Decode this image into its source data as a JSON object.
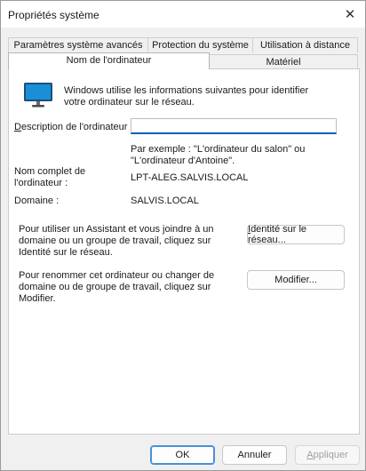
{
  "window": {
    "title": "Propriétés système",
    "close_glyph": "✕"
  },
  "tabs_row1": [
    {
      "label": "Paramètres système avancés"
    },
    {
      "label": "Protection du système"
    },
    {
      "label": "Utilisation à distance"
    }
  ],
  "tabs_row2": [
    {
      "label": "Nom de l'ordinateur",
      "active": true
    },
    {
      "label": "Matériel",
      "active": false
    }
  ],
  "panel": {
    "icon": "monitor-icon",
    "intro": "Windows utilise les informations suivantes pour identifier votre ordinateur sur le réseau.",
    "description_label_mnemonic": "D",
    "description_label_rest": "escription de l'ordinateur :",
    "description_value": "",
    "example_text": "Par exemple : \"L'ordinateur du salon\" ou \"L'ordinateur d'Antoine\".",
    "full_name_label": "Nom complet de l'ordinateur :",
    "full_name_value": "LPT-ALEG.SALVIS.LOCAL",
    "domain_label": "Domaine :",
    "domain_value": "SALVIS.LOCAL",
    "network_id_text": "Pour utiliser un Assistant et vous joindre à un domaine ou un groupe de travail, cliquez sur Identité sur le réseau.",
    "network_id_button_mnemonic": "I",
    "network_id_button_rest": "dentité sur le réseau...",
    "rename_text": "Pour renommer cet ordinateur ou changer de domaine ou de groupe de travail, cliquez sur Modifier.",
    "change_button_label": "Modifier..."
  },
  "footer": {
    "ok_label": "OK",
    "cancel_label": "Annuler",
    "apply_mnemonic": "A",
    "apply_rest": "ppliquer"
  },
  "colors": {
    "accent": "#005fb8",
    "monitor_screen": "#1a8fd8"
  }
}
